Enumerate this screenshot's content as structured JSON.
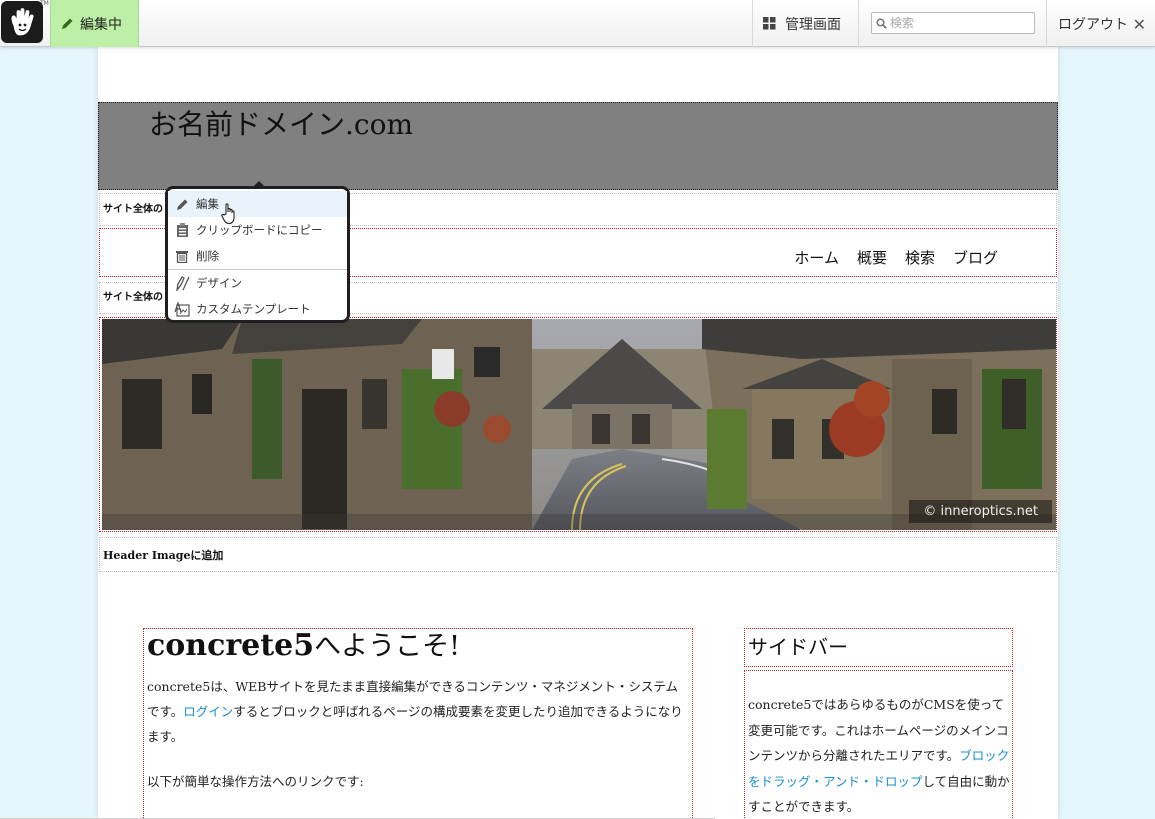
{
  "toolbar": {
    "edit_mode_label": "編集中",
    "admin_label": "管理画面",
    "search_placeholder": "検索",
    "logout_label": "ログアウト",
    "logo_tm": "TM"
  },
  "header": {
    "site_name": "お名前ドメイン.com"
  },
  "areas": {
    "global_area_label_1": "サイト全体の",
    "global_area_label_2": "サイト全体の",
    "header_image_add_label": "Header Imageに追加"
  },
  "nav": {
    "items": [
      "ホーム",
      "概要",
      "検索",
      "ブログ"
    ]
  },
  "hero": {
    "credit": "© inneroptics.net"
  },
  "context_menu": {
    "items": [
      {
        "label": "編集",
        "icon": "pencil-icon"
      },
      {
        "label": "クリップボードにコピー",
        "icon": "clipboard-icon"
      },
      {
        "label": "削除",
        "icon": "trash-icon"
      },
      {
        "label": "デザイン",
        "icon": "design-pen-icon"
      },
      {
        "label": "カスタムテンプレート",
        "icon": "template-icon"
      }
    ]
  },
  "main": {
    "title_part1": "concrete5",
    "title_part2": "へようこそ!",
    "p1_before": "concrete5は、WEBサイトを見たまま直接編集ができるコンテンツ・マネジメント・システムです。",
    "p1_link": "ログイン",
    "p1_after": "するとブロックと呼ばれるページの構成要素を変更したり追加できるようになります。",
    "p2": "以下が簡単な操作方法へのリンクです:"
  },
  "sidebar": {
    "title": "サイドバー",
    "body_before": "concrete5ではあらゆるものがCMSを使って変更可能です。これはホームページのメインコンテンツから分離されたエリアです。",
    "body_link": "ブロックをドラッグ・アンド・ドロップ",
    "body_after": "して自由に動かすことができます。"
  },
  "colors": {
    "edit_mode_bg": "#bdf0a6",
    "link": "#1a8fcf",
    "area_outline": "#c62828",
    "page_bg": "#e6f6fd"
  }
}
